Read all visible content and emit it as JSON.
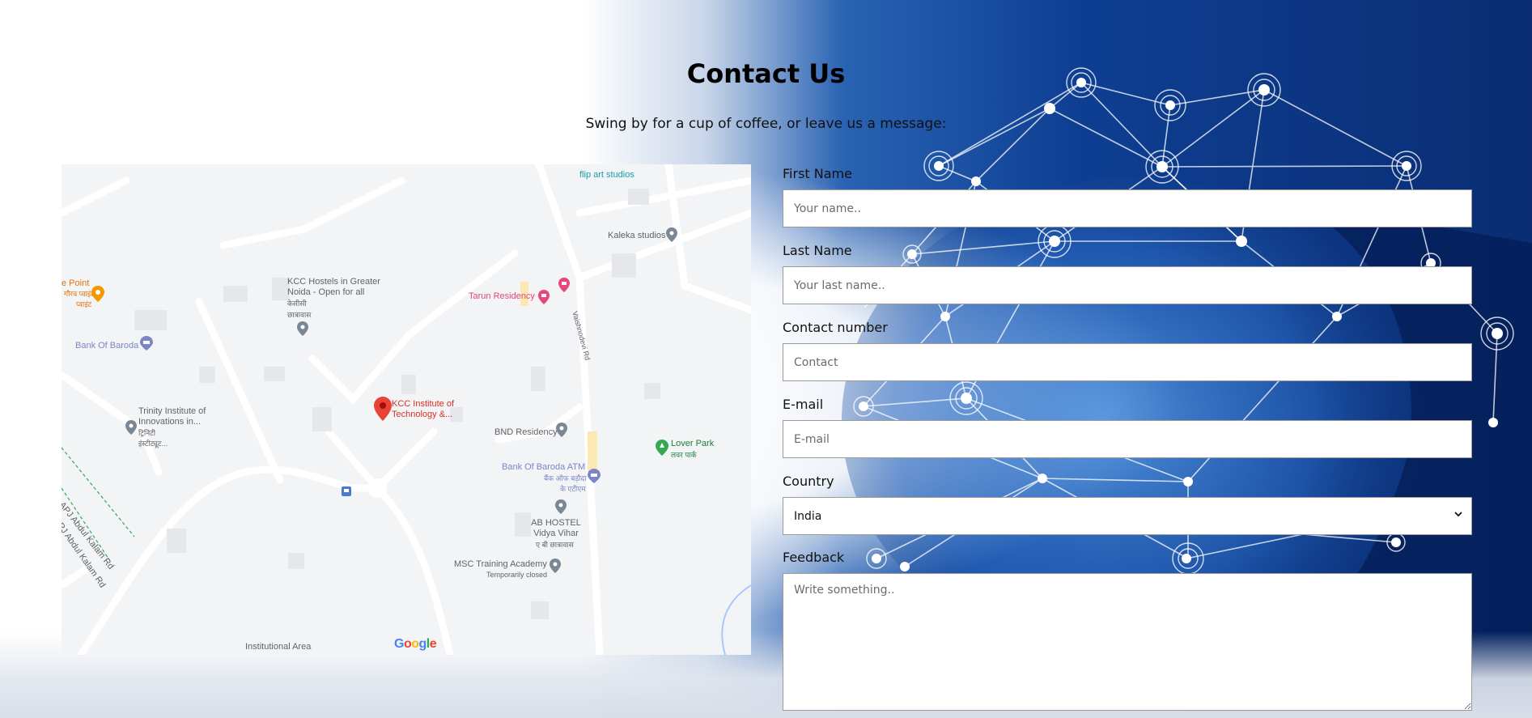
{
  "header": {
    "title": "Contact Us",
    "subtitle": "Swing by for a cup of coffee, or leave us a message:"
  },
  "map": {
    "attribution": "Google",
    "places": [
      {
        "name": "flip art studios"
      },
      {
        "name": "Kaleka studios"
      },
      {
        "name": "KCC Hostels in Greater Noida - Open for all"
      },
      {
        "name": "Tarun Residency"
      },
      {
        "name": "Bank Of Baroda"
      },
      {
        "name": "KCC Institute of Technology &..."
      },
      {
        "name": "Trinity Institute of Innovations in..."
      },
      {
        "name": "BND Residency"
      },
      {
        "name": "Bank Of Baroda ATM"
      },
      {
        "name": "Lover Park"
      },
      {
        "name": "AB HOSTEL Vidya Vihar"
      },
      {
        "name": "MSC Training Academy"
      },
      {
        "name": "Temporarily closed"
      },
      {
        "name": "Institutional Area"
      },
      {
        "name": "e Point"
      },
      {
        "name": "APJ Abdul Kalam Rd"
      },
      {
        "name": "Vaishnodevi Rd"
      }
    ],
    "hindi_labels": {
      "kcc_hostels": "केसीसी",
      "kcc_hostels_2": "छात्रावास",
      "trinity_1": "ट्रिनिटी",
      "trinity_2": "इंस्टीट्यूट...",
      "atm_1": "बैंक ऑफ बड़ौदा",
      "atm_2": "के एटीएम",
      "lover_park": "लवर पार्क",
      "ab_hostel": "ए बी छात्रावास",
      "e_point_1": "गौरव प्वाइंट",
      "e_point_2": "प्वाइंट"
    }
  },
  "form": {
    "first_name": {
      "label": "First Name",
      "placeholder": "Your name.."
    },
    "last_name": {
      "label": "Last Name",
      "placeholder": "Your last name.."
    },
    "contact": {
      "label": "Contact number",
      "placeholder": "Contact"
    },
    "email": {
      "label": "E-mail",
      "placeholder": "E-mail"
    },
    "country": {
      "label": "Country",
      "value": "India",
      "options": [
        "India"
      ]
    },
    "feedback": {
      "label": "Feedback",
      "placeholder": "Write something.."
    }
  },
  "colors": {
    "background_blue": "#0e3f93",
    "map_background": "#f3f4f6",
    "pin_red": "#ea4335",
    "pin_pink": "#e8457c",
    "pin_blue": "#7b86c8",
    "pin_green": "#34a853",
    "pin_gray": "#7a8794"
  },
  "icons": [
    "location-pin-icon",
    "bank-icon",
    "hotel-icon",
    "park-icon",
    "bus-stop-icon",
    "chevron-down-icon"
  ]
}
